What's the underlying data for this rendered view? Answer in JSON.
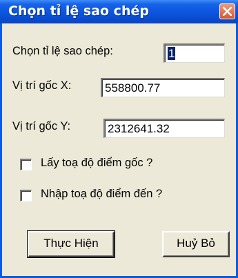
{
  "window": {
    "title": "Chọn tỉ lệ sao chép",
    "close_icon": "close-icon",
    "title_color": "#0a52db"
  },
  "form": {
    "scale_label": "Chọn tỉ lệ sao chép:",
    "scale_value": "1",
    "origin_x_label": "Vị trí gốc X:",
    "origin_x_value": "558800.77",
    "origin_y_label": "Vị trí gốc Y:",
    "origin_y_value": "2312641.32",
    "get_origin_checkbox_label": "Lấy toạ độ điểm gốc ?",
    "get_origin_checked": false,
    "enter_dest_checkbox_label": "Nhập toạ độ điểm đến ?",
    "enter_dest_checked": false
  },
  "buttons": {
    "execute_label": "Thực Hiện",
    "cancel_label": "Huỷ Bỏ"
  }
}
